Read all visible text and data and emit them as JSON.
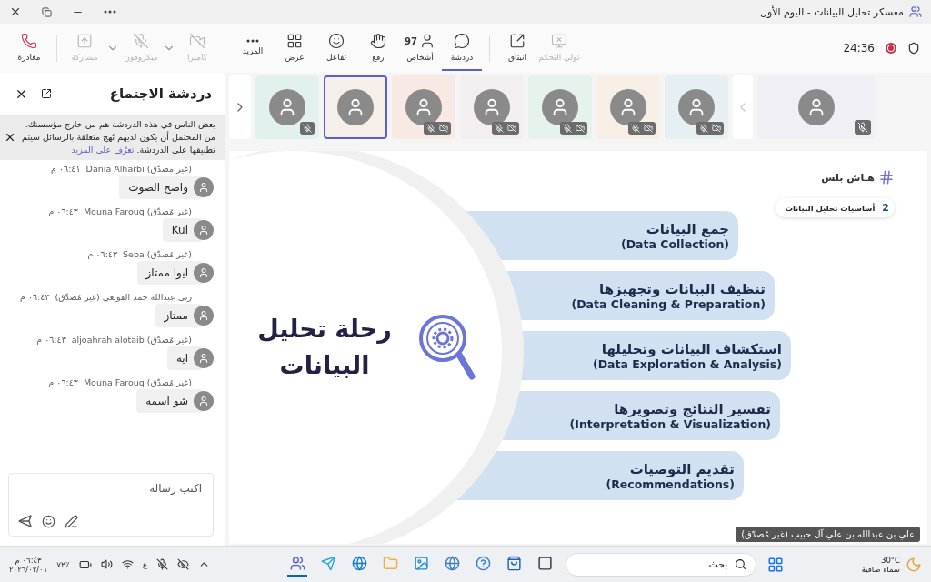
{
  "window": {
    "title": "معسكر تحليل البيانات - اليوم الأول"
  },
  "toolbar": {
    "buttons": [
      {
        "kind": "control",
        "label": "تولي التحكم",
        "disabled": true,
        "selected": false,
        "has_menu": false
      },
      {
        "kind": "popout",
        "label": "انبثاق",
        "disabled": false,
        "selected": false,
        "has_menu": false
      },
      {
        "kind": "chat",
        "label": "دردشة",
        "disabled": false,
        "selected": true,
        "has_menu": false
      },
      {
        "kind": "people",
        "label": "أشخاص",
        "count": "97",
        "disabled": false,
        "selected": false,
        "has_menu": false
      },
      {
        "kind": "raise",
        "label": "رفع",
        "disabled": false,
        "selected": false,
        "has_menu": false
      },
      {
        "kind": "react",
        "label": "تفاعل",
        "disabled": false,
        "selected": false,
        "has_menu": false
      },
      {
        "kind": "view",
        "label": "عرض",
        "disabled": false,
        "selected": false,
        "has_menu": false
      },
      {
        "kind": "more",
        "label": "المزيد",
        "disabled": false,
        "selected": false,
        "has_menu": false
      },
      {
        "kind": "camera",
        "label": "كاميرا",
        "disabled": true,
        "selected": false,
        "has_menu": true
      },
      {
        "kind": "mic",
        "label": "ميكروفون",
        "disabled": true,
        "selected": false,
        "has_menu": true
      },
      {
        "kind": "share",
        "label": "مشاركة",
        "disabled": true,
        "selected": false,
        "has_menu": false
      },
      {
        "kind": "leave",
        "label": "مغادرة",
        "disabled": false,
        "selected": false,
        "has_menu": false
      }
    ],
    "timer": "24:36",
    "recording": true
  },
  "chat": {
    "title": "دردشة الاجتماع",
    "notice": {
      "text": "بعض الناس في هذه الدردشة هم من خارج مؤسستك. من المحتمل أن يكون لديهم نُهج متعلقة بالرسائل سيتم تطبيقها على الدردشة.",
      "link": "تعرّف على المزيد"
    },
    "messages": [
      {
        "sender": "Dania Alharbi (غير مصدّق)",
        "time": "٠٦:٤١ م",
        "text": "واضح الصوت"
      },
      {
        "sender": "Mouna Farouq (غير مُصدّق)",
        "time": "٠٦:٤٣ م",
        "text": "Kul"
      },
      {
        "sender": "Seba (غير مُصدّق)",
        "time": "٠٦:٤٣ م",
        "text": "ايوا ممتاز"
      },
      {
        "sender": "ربى عبدالله حمد القويعي (غير مُصدّق)",
        "time": "٠٦:٤٣ م",
        "text": "ممتاز"
      },
      {
        "sender": "aljoahrah alotaib (غير مُصدّق)",
        "time": "٠٦:٤٣ م",
        "text": "ايه"
      },
      {
        "sender": "Mouna Farouq (غير مُصدّق)",
        "time": "٠٦:٤٣ م",
        "text": "شو اسمه"
      }
    ],
    "compose": {
      "placeholder": "اكتب رسالة"
    }
  },
  "stage": {
    "tiles": [
      {
        "selected": false,
        "mic_muted": true,
        "camera_off": false,
        "color": "#e3f1ee"
      },
      {
        "selected": true,
        "mic_muted": false,
        "camera_off": false,
        "color": "#f6efe9"
      },
      {
        "selected": false,
        "mic_muted": true,
        "camera_off": true,
        "color": "#f8e9e4"
      },
      {
        "selected": false,
        "mic_muted": true,
        "camera_off": true,
        "color": "#f3eeef"
      },
      {
        "selected": false,
        "mic_muted": true,
        "camera_off": true,
        "color": "#e6f3ec"
      },
      {
        "selected": false,
        "mic_muted": true,
        "camera_off": true,
        "color": "#f7efe6"
      },
      {
        "selected": false,
        "mic_muted": true,
        "camera_off": true,
        "color": "#e6f0f4"
      }
    ],
    "main_tile": {
      "mic_muted": true
    },
    "slide": {
      "brand": "هـاش بلس",
      "chip": {
        "number": "2",
        "label": "أساسيات تحليل البيانات"
      },
      "title": "رحلة تحليل البيانات",
      "steps": [
        {
          "ar": "جمع البيانات",
          "en": "(Data Collection)"
        },
        {
          "ar": "تنظيف البيانات وتجهيزها",
          "en": "(Data Cleaning & Preparation)"
        },
        {
          "ar": "استكشاف البيانات وتحليلها",
          "en": "(Data Exploration & Analysis)"
        },
        {
          "ar": "تفسير النتائج وتصويرها",
          "en": "(Interpretation & Visualization)"
        },
        {
          "ar": "تقديم التوصيات",
          "en": "(Recommendations)"
        }
      ]
    },
    "presenter": "علي بن عبدالله بن علي آل حبيب (غير مُصدّق)"
  },
  "taskbar": {
    "time": "٠٦:٤٣ م",
    "date": "٢٠٢٦/٠٢/٠١",
    "battery": "٧٢٪",
    "language": "ع",
    "search": {
      "placeholder": "بحث"
    },
    "weather": {
      "temp": "30°C",
      "condition": "سماء صافية"
    },
    "apps": [
      {
        "kind": "teams",
        "active": true
      },
      {
        "kind": "telegram",
        "active": false
      },
      {
        "kind": "edge",
        "active": false
      },
      {
        "kind": "folder",
        "active": false
      },
      {
        "kind": "photos",
        "active": false
      },
      {
        "kind": "globe",
        "active": false
      },
      {
        "kind": "help",
        "active": false
      },
      {
        "kind": "store",
        "active": false
      },
      {
        "kind": "terminal",
        "active": false
      }
    ]
  }
}
